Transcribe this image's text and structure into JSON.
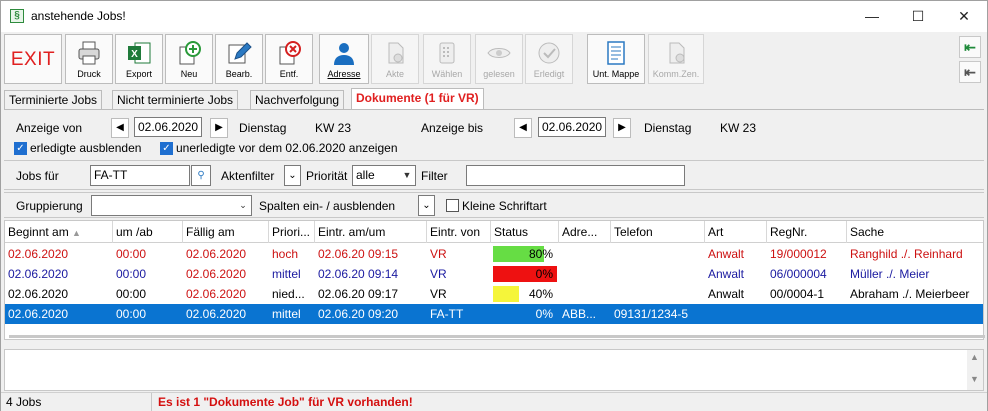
{
  "window": {
    "title": "anstehende Jobs!",
    "app_icon": "§"
  },
  "toolbar": {
    "exit": "EXIT",
    "buttons": [
      {
        "label": "Druck",
        "icon": "printer-icon"
      },
      {
        "label": "Export",
        "icon": "excel-icon"
      },
      {
        "label": "Neu",
        "icon": "add-icon"
      },
      {
        "label": "Bearb.",
        "icon": "edit-icon"
      },
      {
        "label": "Entf.",
        "icon": "delete-icon"
      },
      {
        "label": "Adresse",
        "icon": "person-icon"
      },
      {
        "label": "Akte",
        "icon": "file-icon"
      },
      {
        "label": "Wählen",
        "icon": "dial-icon"
      },
      {
        "label": "gelesen",
        "icon": "eye-icon"
      },
      {
        "label": "Erledigt",
        "icon": "check-icon"
      },
      {
        "label": "Unt. Mappe",
        "icon": "folder-icon"
      },
      {
        "label": "Komm.Zen.",
        "icon": "comm-icon"
      }
    ]
  },
  "tabs": [
    {
      "label": "Terminierte Jobs"
    },
    {
      "label": "Nicht terminierte Jobs"
    },
    {
      "label": "Nachverfolgung"
    },
    {
      "label": "Dokumente (1 für VR)"
    }
  ],
  "range": {
    "from_label": "Anzeige von",
    "from_date": "02.06.2020",
    "from_weekday": "Dienstag",
    "from_kw": "KW 23",
    "to_label": "Anzeige bis",
    "to_date": "02.06.2020",
    "to_weekday": "Dienstag",
    "to_kw": "KW 23",
    "hide_done": "erledigte ausblenden",
    "show_open_before": "unerledigte vor dem 02.06.2020 anzeigen"
  },
  "filters": {
    "jobs_label": "Jobs für",
    "jobs_value": "FA-TT",
    "aktenfilter_label": "Aktenfilter",
    "prioritaet_label": "Priorität",
    "prioritaet_value": "alle",
    "filter_label": "Filter",
    "filter_value": "",
    "gruppierung_label": "Gruppierung",
    "gruppierung_value": "",
    "spalten_label": "Spalten ein- / ausblenden",
    "kleine_schrift": "Kleine Schriftart"
  },
  "grid": {
    "columns": [
      "Beginnt am",
      "um /ab",
      "Fällig am",
      "Priori...",
      "Eintr. am/um",
      "Eintr. von",
      "Status",
      "Adre...",
      "Telefon",
      "Art",
      "RegNr.",
      "Sache"
    ],
    "rows": [
      {
        "beginnt": "02.06.2020",
        "um": "00:00",
        "faellig": "02.06.2020",
        "prio": "hoch",
        "eintr": "02.06.20 09:15",
        "von": "VR",
        "status": "80%",
        "status_fill": 0.8,
        "status_color": "#66dd44",
        "adresse": "",
        "telefon": "",
        "art": "Anwalt",
        "regnr": "19/000012",
        "sache": "Ranghild ./. Reinhard",
        "color": "#cc1111",
        "faellig_color": "#cc1111"
      },
      {
        "beginnt": "02.06.2020",
        "um": "00:00",
        "faellig": "02.06.2020",
        "prio": "mittel",
        "eintr": "02.06.20 09:14",
        "von": "VR",
        "status": "0%",
        "status_fill": 1,
        "status_color": "#ee1111",
        "adresse": "",
        "telefon": "",
        "art": "Anwalt",
        "regnr": "06/000004",
        "sache": "Müller ./. Meier",
        "color": "#1a1aa0",
        "faellig_color": "#cc1111"
      },
      {
        "beginnt": "02.06.2020",
        "um": "00:00",
        "faellig": "02.06.2020",
        "prio": "nied...",
        "eintr": "02.06.20 09:17",
        "von": "VR",
        "status": "40%",
        "status_fill": 0.4,
        "status_color": "#f5f53a",
        "adresse": "",
        "telefon": "",
        "art": "Anwalt",
        "regnr": "00/0004-1",
        "sache": "Abraham ./. Meierbeer",
        "color": "#000000",
        "faellig_color": "#cc1111"
      },
      {
        "beginnt": "02.06.2020",
        "um": "00:00",
        "faellig": "02.06.2020",
        "prio": "mittel",
        "eintr": "02.06.20 09:20",
        "von": "FA-TT",
        "status": "0%",
        "status_fill": 0,
        "status_color": "#0a74d1",
        "adresse": "ABB...",
        "telefon": "09131/1234-5",
        "art": "",
        "regnr": "",
        "sache": "",
        "color": "#ffffff",
        "faellig_color": "#ffffff"
      }
    ]
  },
  "status": {
    "count": "4 Jobs",
    "message": "Es ist 1 \"Dokumente Job\" für VR vorhanden!"
  }
}
